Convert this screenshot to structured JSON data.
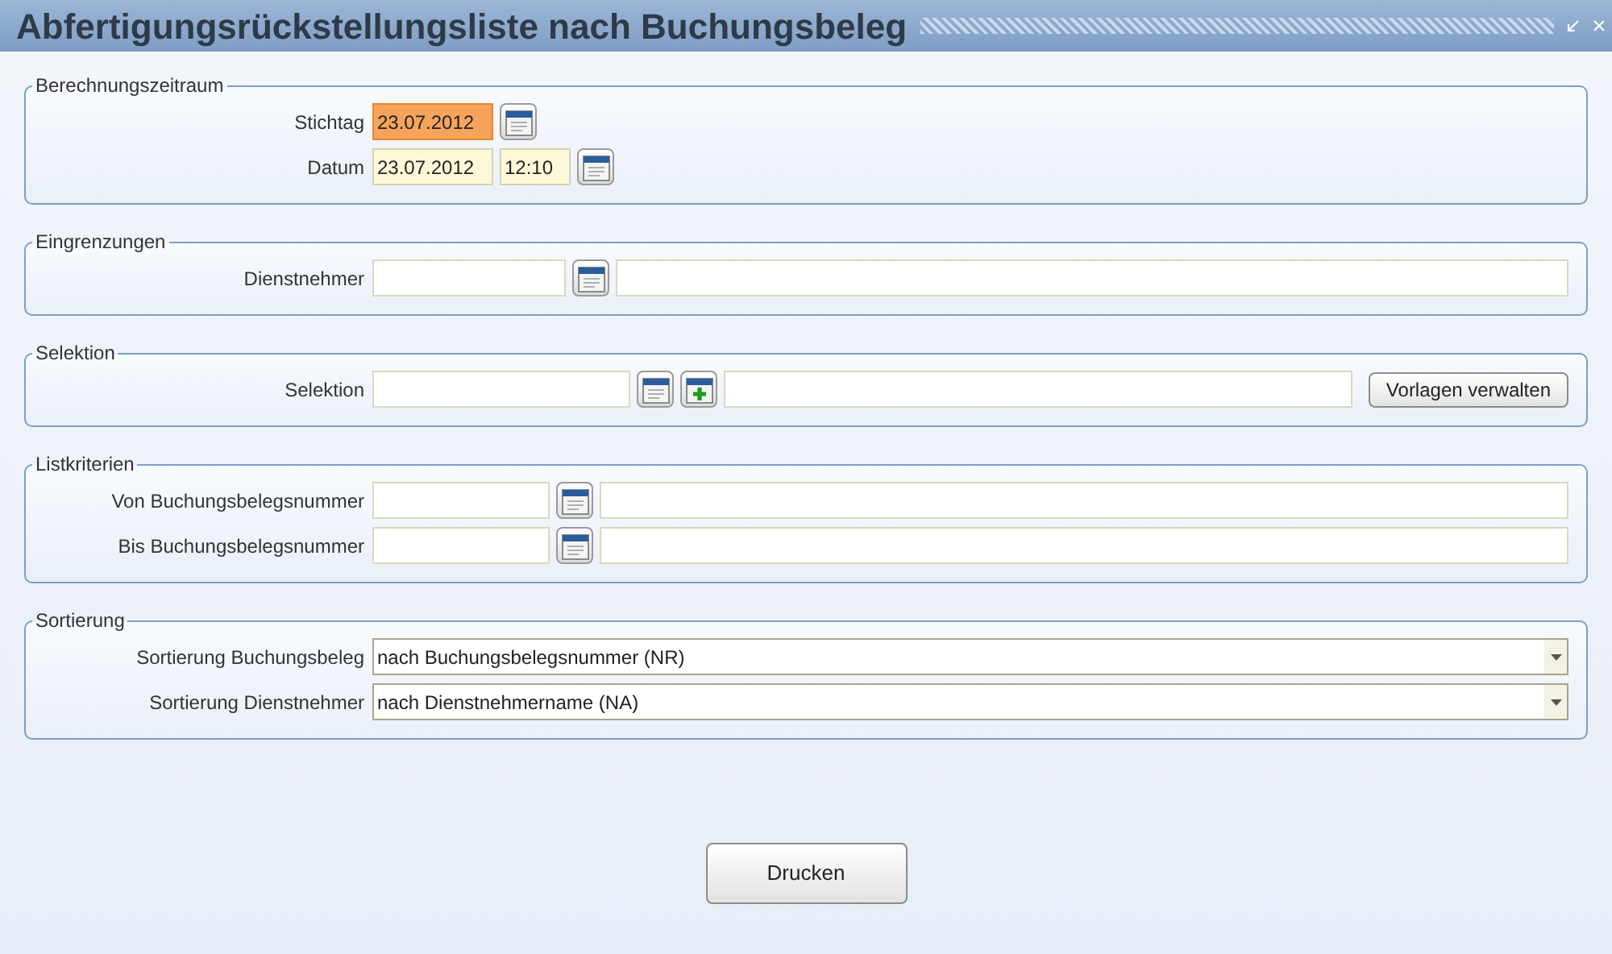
{
  "window": {
    "title": "Abfertigungsrückstellungsliste nach Buchungsbeleg"
  },
  "sections": [
    {
      "title": "Berechnungszeitraum",
      "rows": [
        {
          "label": "Stichtag",
          "controls": [
            {
              "kind": "date",
              "value": "23.07.2012",
              "focused": true
            },
            {
              "kind": "lookup"
            }
          ]
        },
        {
          "label": "Datum",
          "controls": [
            {
              "kind": "date",
              "value": "23.07.2012",
              "focused": false
            },
            {
              "kind": "time",
              "value": "12:10",
              "focused": false
            },
            {
              "kind": "lookup"
            }
          ]
        }
      ]
    },
    {
      "title": "Eingrenzungen",
      "rows": [
        {
          "label": "Dienstnehmer",
          "controls": [
            {
              "kind": "code",
              "focused": false
            },
            {
              "kind": "lookup"
            },
            {
              "kind": "wide",
              "focused": false
            }
          ]
        }
      ]
    },
    {
      "title": "Selektion",
      "rows": [
        {
          "label": "Selektion",
          "controls": [
            {
              "kind": "selection",
              "focused": false
            },
            {
              "kind": "lookup"
            },
            {
              "kind": "add"
            },
            {
              "kind": "wide",
              "focused": false
            },
            {
              "kind": "button",
              "value": "Vorlagen verwalten"
            }
          ]
        }
      ]
    },
    {
      "title": "Listkriterien",
      "rows": [
        {
          "label": "Von Buchungsbelegsnummer",
          "controls": [
            {
              "kind": "number",
              "focused": false
            },
            {
              "kind": "lookup"
            },
            {
              "kind": "wide",
              "focused": false
            }
          ]
        },
        {
          "label": "Bis Buchungsbelegsnummer",
          "controls": [
            {
              "kind": "number",
              "focused": false
            },
            {
              "kind": "lookup"
            },
            {
              "kind": "wide",
              "focused": false
            }
          ]
        }
      ]
    },
    {
      "title": "Sortierung",
      "rows": [
        {
          "label": "Sortierung Buchungsbeleg",
          "controls": [
            {
              "kind": "select",
              "value": "nach Buchungsbelegsnummer (NR)"
            }
          ]
        },
        {
          "label": "Sortierung Dienstnehmer",
          "controls": [
            {
              "kind": "select",
              "value": "nach Dienstnehmername (NA)"
            }
          ]
        }
      ]
    }
  ],
  "print_button": "Drucken"
}
